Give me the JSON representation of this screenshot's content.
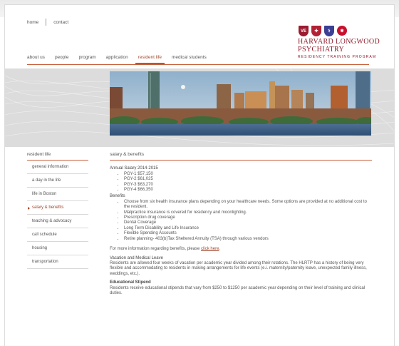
{
  "utility_nav": {
    "home": "home",
    "contact": "contact"
  },
  "logo": {
    "line1": "HARVARD LONGWOOD",
    "line2": "PSYCHIATRY",
    "line3": "RESIDENCY TRAINING PROGRAM"
  },
  "main_nav": [
    "about us",
    "people",
    "program",
    "application",
    "resident life",
    "medical students"
  ],
  "main_nav_active": "resident life",
  "sidebar": {
    "title": "resident life",
    "items": [
      "general information",
      "a day in the life",
      "life in Boston",
      "salary & benefits",
      "teaching & advocacy",
      "call schedule",
      "housing",
      "transportation"
    ],
    "active": "salary & benefits"
  },
  "content": {
    "title": "salary & benefits",
    "salary_heading": "Annual Salary 2014-2015",
    "salaries": [
      "PGY-1 $57,150",
      "PGY-2 $61,025",
      "PGY-3 $63,270",
      "PGY-4 $66,350"
    ],
    "benefits_heading": "Benefits",
    "benefits": [
      "Choose from six health insurance plans depending on your healthcare needs. Some options are provided at no additional cost to the resident.",
      "Malpractice insurance is covered for residency and moonlighting.",
      "Prescription drug coverage",
      "Dental Coverage",
      "Long Term Disability and Life Insurance",
      "Flexible Spending Accounts",
      "Retire planning- 403(b)Tax Sheltered Annuity (TSA) through various vendors"
    ],
    "more_info_prefix": "For more information regarding benefits, please ",
    "more_info_link": "click here",
    "more_info_suffix": ".",
    "vacation_heading": "Vacation and Medical Leave",
    "vacation_text": "Residents are allowed four weeks of vacation per academic year divided among their rotations. The HLRTP has a history of being very flexible and accommodating to residents in making arrangements for life events (e.i. maternity/paternity leave, unexpected family illness, weddings, etc.).",
    "stipend_heading": "Educational Stipend",
    "stipend_text": "Residents receive educational stipends that vary from $250 to $1250 per academic year depending on their level of training and clinical duties."
  },
  "colors": {
    "accent": "#c8613d",
    "active_text": "#a3472c",
    "logo": "#8e1b2b"
  }
}
